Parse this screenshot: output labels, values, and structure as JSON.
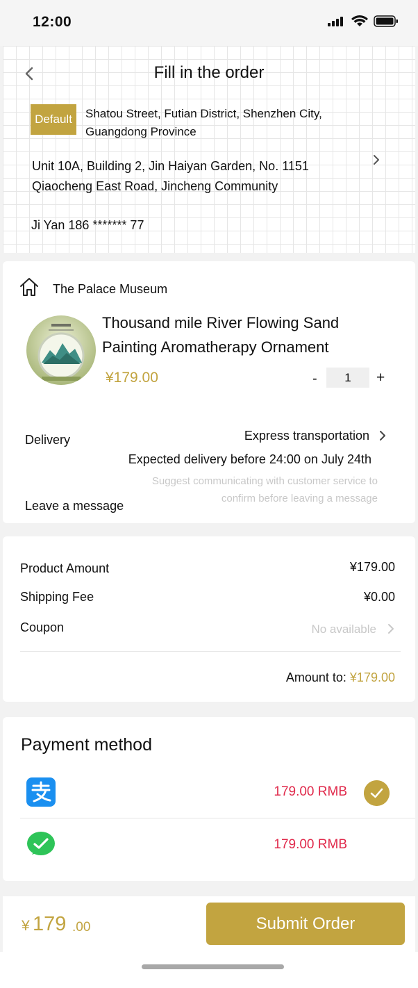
{
  "status_bar": {
    "time": "12:00",
    "icons": [
      "signal-icon",
      "wifi-icon",
      "battery-icon"
    ]
  },
  "header": {
    "title": "Fill in the order",
    "back_icon": "chevron-left-icon"
  },
  "address": {
    "badge": "Default",
    "line1": "Shatou Street, Futian District, Shenzhen City, Guangdong Province",
    "line2": "Unit 10A, Building 2, Jin Haiyan Garden, No. 1151 Qiaocheng East Road, Jincheng Community",
    "contact": "Ji Yan 186 ******* 77"
  },
  "product": {
    "shop_name": "The Palace Museum",
    "name": "Thousand mile River Flowing Sand Painting Aromatherapy Ornament",
    "price": "¥179.00",
    "quantity": "1",
    "minus": "-",
    "plus": "+",
    "delivery_label": "Delivery",
    "delivery_type": "Express transportation",
    "delivery_eta": "Expected delivery before 24:00 on July 24th",
    "message_label": "Leave a message",
    "message_placeholder": "Suggest communicating with customer service to confirm before leaving a message"
  },
  "summary": {
    "product_amount_label": "Product Amount",
    "product_amount": "¥179.00",
    "shipping_label": "Shipping Fee",
    "shipping": "¥0.00",
    "coupon_label": "Coupon",
    "coupon_value": "No available",
    "amount_label": "Amount to:",
    "amount_value": "¥179.00"
  },
  "payment": {
    "title": "Payment method",
    "methods": [
      {
        "icon": "alipay-icon",
        "amount": "179.00 RMB",
        "selected": true
      },
      {
        "icon": "wechat-pay-icon",
        "amount": "179.00 RMB",
        "selected": false
      }
    ]
  },
  "footer": {
    "currency": "¥",
    "total_int": "179",
    "total_dec": ".00",
    "submit_label": "Submit Order"
  },
  "colors": {
    "accent": "#c2a440",
    "price_red": "#e0284a",
    "hint_gray": "#c8c8c8"
  }
}
